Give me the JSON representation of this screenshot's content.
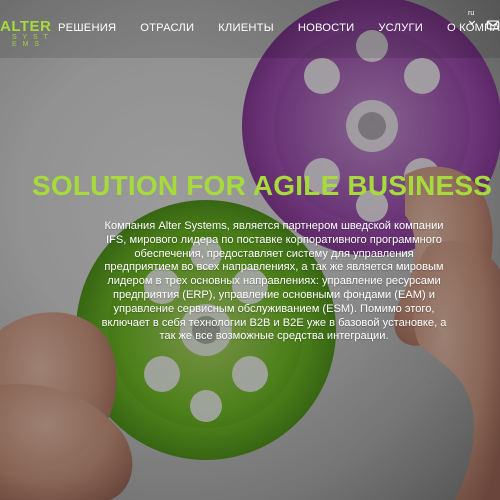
{
  "header": {
    "logo_main": "ALTER",
    "logo_sub": "S Y S T E M S",
    "nav": [
      "РЕШЕНИЯ",
      "ОТРАСЛИ",
      "КЛИЕНТЫ",
      "НОВОСТИ",
      "УСЛУГИ",
      "О КОМПАНИИ"
    ],
    "language": "ru"
  },
  "hero": {
    "headline": "SOLUTION FOR AGILE BUSINESS",
    "text": "Компания Alter Systems, является партнером шведской компании IFS, мирового лидера по поставке корпоративного программного обеспечения, предоставляет систему для управления предприятием во всех направлениях, а так же является мировым лидером в трех основных направлениях: управление ресурсами предприятия (ERP), управление основными фондами (EAM) и управление сервисным обслуживанием (ESM). Помимо этого, включает в себя технологии B2B и B2E уже в базовой установке, а так же все возможные средства интеграции."
  },
  "colors": {
    "accent": "#a7db3b",
    "purple_gear": "#b35fc6",
    "green_gear": "#7ccf2a"
  },
  "icons": {
    "mail": "mail-icon",
    "language_chevron": "chevron-down-icon"
  }
}
